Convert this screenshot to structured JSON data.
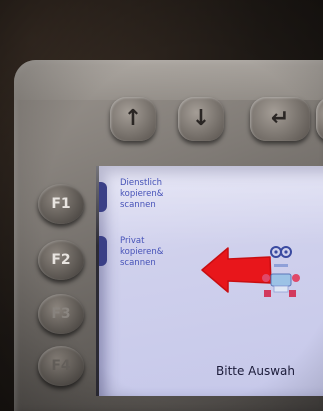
{
  "nav_buttons": {
    "up_icon": "↑",
    "down_icon": "↓",
    "enter_icon": "↵"
  },
  "function_keys": [
    "F1",
    "F2",
    "F3",
    "F4"
  ],
  "screen": {
    "option1_lines": [
      "Dienstlich",
      "kopieren&",
      "scannen"
    ],
    "option2_lines": [
      "Privat",
      "kopieren&",
      "scannen"
    ],
    "prompt": "Bitte Auswah"
  },
  "colors": {
    "arrow": "#e8161b",
    "screen": "#cfd0ec",
    "option_text": "#4652b8"
  }
}
